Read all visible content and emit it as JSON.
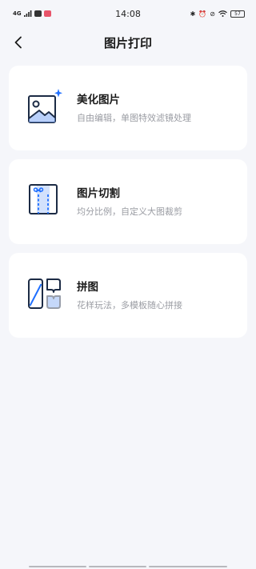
{
  "status_bar": {
    "network": "4G",
    "time": "14:08",
    "battery": "57"
  },
  "header": {
    "title": "图片打印"
  },
  "options": [
    {
      "title": "美化图片",
      "subtitle": "自由编辑，单图特效滤镜处理",
      "icon": "image-beautify-icon"
    },
    {
      "title": "图片切割",
      "subtitle": "均分比例，自定义大图裁剪",
      "icon": "image-cut-icon"
    },
    {
      "title": "拼图",
      "subtitle": "花样玩法，多模板随心拼接",
      "icon": "collage-icon"
    }
  ],
  "colors": {
    "accent": "#1f6fff",
    "icon_stroke": "#1c2b45",
    "background": "#f5f6fa"
  }
}
